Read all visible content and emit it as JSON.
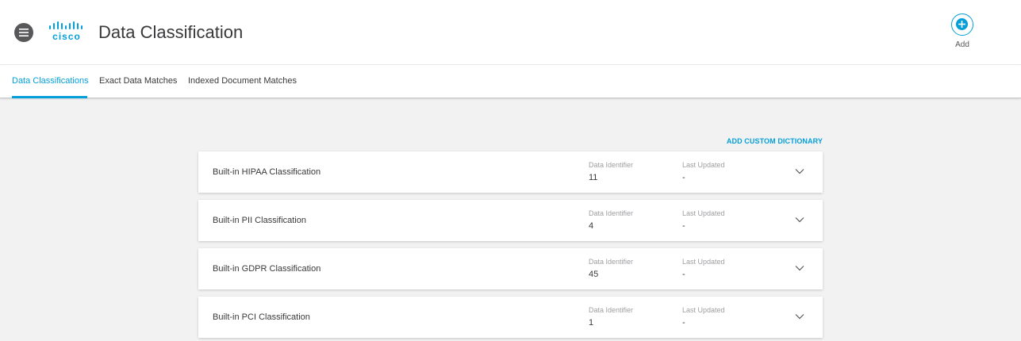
{
  "header": {
    "title": "Data Classification",
    "logo_text": "cisco",
    "add_label": "Add"
  },
  "tabs": [
    {
      "label": "Data Classifications",
      "active": true
    },
    {
      "label": "Exact Data Matches",
      "active": false
    },
    {
      "label": "Indexed Document Matches",
      "active": false
    }
  ],
  "actions": {
    "add_custom_dictionary": "ADD CUSTOM DICTIONARY"
  },
  "column_labels": {
    "data_identifier": "Data Identifier",
    "last_updated": "Last Updated"
  },
  "classifications": [
    {
      "name": "Built-in HIPAA Classification",
      "data_identifier": "11",
      "last_updated": "-"
    },
    {
      "name": "Built-in PII Classification",
      "data_identifier": "4",
      "last_updated": "-"
    },
    {
      "name": "Built-in GDPR Classification",
      "data_identifier": "45",
      "last_updated": "-"
    },
    {
      "name": "Built-in PCI Classification",
      "data_identifier": "1",
      "last_updated": "-"
    }
  ],
  "colors": {
    "accent": "#049fd9",
    "text": "#39393b",
    "muted": "#9e9ea2",
    "background": "#f2f2f2"
  },
  "icons": {
    "menu": "hamburger-menu-icon",
    "add": "plus-circle-icon",
    "expand": "chevron-down-icon",
    "logo": "cisco-logo"
  }
}
